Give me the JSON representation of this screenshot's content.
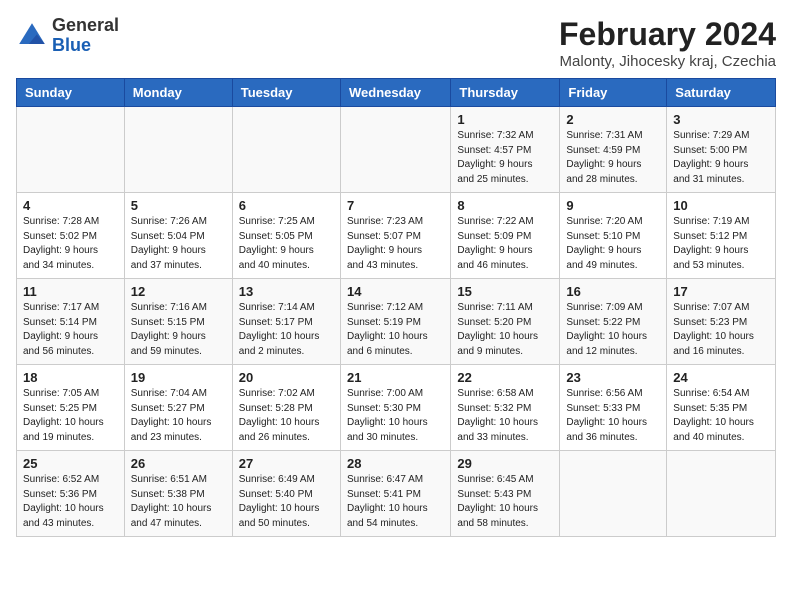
{
  "header": {
    "logo": {
      "line1": "General",
      "line2": "Blue"
    },
    "month_year": "February 2024",
    "location": "Malonty, Jihocesky kraj, Czechia"
  },
  "days_of_week": [
    "Sunday",
    "Monday",
    "Tuesday",
    "Wednesday",
    "Thursday",
    "Friday",
    "Saturday"
  ],
  "weeks": [
    [
      {
        "day": "",
        "info": ""
      },
      {
        "day": "",
        "info": ""
      },
      {
        "day": "",
        "info": ""
      },
      {
        "day": "",
        "info": ""
      },
      {
        "day": "1",
        "info": "Sunrise: 7:32 AM\nSunset: 4:57 PM\nDaylight: 9 hours\nand 25 minutes."
      },
      {
        "day": "2",
        "info": "Sunrise: 7:31 AM\nSunset: 4:59 PM\nDaylight: 9 hours\nand 28 minutes."
      },
      {
        "day": "3",
        "info": "Sunrise: 7:29 AM\nSunset: 5:00 PM\nDaylight: 9 hours\nand 31 minutes."
      }
    ],
    [
      {
        "day": "4",
        "info": "Sunrise: 7:28 AM\nSunset: 5:02 PM\nDaylight: 9 hours\nand 34 minutes."
      },
      {
        "day": "5",
        "info": "Sunrise: 7:26 AM\nSunset: 5:04 PM\nDaylight: 9 hours\nand 37 minutes."
      },
      {
        "day": "6",
        "info": "Sunrise: 7:25 AM\nSunset: 5:05 PM\nDaylight: 9 hours\nand 40 minutes."
      },
      {
        "day": "7",
        "info": "Sunrise: 7:23 AM\nSunset: 5:07 PM\nDaylight: 9 hours\nand 43 minutes."
      },
      {
        "day": "8",
        "info": "Sunrise: 7:22 AM\nSunset: 5:09 PM\nDaylight: 9 hours\nand 46 minutes."
      },
      {
        "day": "9",
        "info": "Sunrise: 7:20 AM\nSunset: 5:10 PM\nDaylight: 9 hours\nand 49 minutes."
      },
      {
        "day": "10",
        "info": "Sunrise: 7:19 AM\nSunset: 5:12 PM\nDaylight: 9 hours\nand 53 minutes."
      }
    ],
    [
      {
        "day": "11",
        "info": "Sunrise: 7:17 AM\nSunset: 5:14 PM\nDaylight: 9 hours\nand 56 minutes."
      },
      {
        "day": "12",
        "info": "Sunrise: 7:16 AM\nSunset: 5:15 PM\nDaylight: 9 hours\nand 59 minutes."
      },
      {
        "day": "13",
        "info": "Sunrise: 7:14 AM\nSunset: 5:17 PM\nDaylight: 10 hours\nand 2 minutes."
      },
      {
        "day": "14",
        "info": "Sunrise: 7:12 AM\nSunset: 5:19 PM\nDaylight: 10 hours\nand 6 minutes."
      },
      {
        "day": "15",
        "info": "Sunrise: 7:11 AM\nSunset: 5:20 PM\nDaylight: 10 hours\nand 9 minutes."
      },
      {
        "day": "16",
        "info": "Sunrise: 7:09 AM\nSunset: 5:22 PM\nDaylight: 10 hours\nand 12 minutes."
      },
      {
        "day": "17",
        "info": "Sunrise: 7:07 AM\nSunset: 5:23 PM\nDaylight: 10 hours\nand 16 minutes."
      }
    ],
    [
      {
        "day": "18",
        "info": "Sunrise: 7:05 AM\nSunset: 5:25 PM\nDaylight: 10 hours\nand 19 minutes."
      },
      {
        "day": "19",
        "info": "Sunrise: 7:04 AM\nSunset: 5:27 PM\nDaylight: 10 hours\nand 23 minutes."
      },
      {
        "day": "20",
        "info": "Sunrise: 7:02 AM\nSunset: 5:28 PM\nDaylight: 10 hours\nand 26 minutes."
      },
      {
        "day": "21",
        "info": "Sunrise: 7:00 AM\nSunset: 5:30 PM\nDaylight: 10 hours\nand 30 minutes."
      },
      {
        "day": "22",
        "info": "Sunrise: 6:58 AM\nSunset: 5:32 PM\nDaylight: 10 hours\nand 33 minutes."
      },
      {
        "day": "23",
        "info": "Sunrise: 6:56 AM\nSunset: 5:33 PM\nDaylight: 10 hours\nand 36 minutes."
      },
      {
        "day": "24",
        "info": "Sunrise: 6:54 AM\nSunset: 5:35 PM\nDaylight: 10 hours\nand 40 minutes."
      }
    ],
    [
      {
        "day": "25",
        "info": "Sunrise: 6:52 AM\nSunset: 5:36 PM\nDaylight: 10 hours\nand 43 minutes."
      },
      {
        "day": "26",
        "info": "Sunrise: 6:51 AM\nSunset: 5:38 PM\nDaylight: 10 hours\nand 47 minutes."
      },
      {
        "day": "27",
        "info": "Sunrise: 6:49 AM\nSunset: 5:40 PM\nDaylight: 10 hours\nand 50 minutes."
      },
      {
        "day": "28",
        "info": "Sunrise: 6:47 AM\nSunset: 5:41 PM\nDaylight: 10 hours\nand 54 minutes."
      },
      {
        "day": "29",
        "info": "Sunrise: 6:45 AM\nSunset: 5:43 PM\nDaylight: 10 hours\nand 58 minutes."
      },
      {
        "day": "",
        "info": ""
      },
      {
        "day": "",
        "info": ""
      }
    ]
  ]
}
